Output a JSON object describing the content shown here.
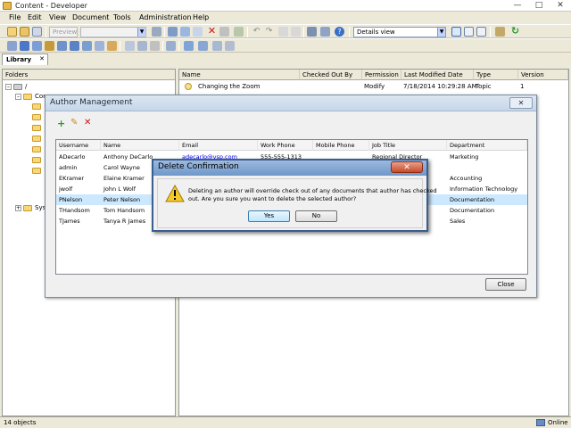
{
  "window": {
    "title": "Content - Developer",
    "controls": [
      "minimize",
      "maximize",
      "close"
    ]
  },
  "menu": [
    "File",
    "Edit",
    "View",
    "Document",
    "Tools",
    "Administration",
    "Help"
  ],
  "toolbar": {
    "preview_label": "Preview",
    "view_select": "Details view"
  },
  "library_tab": {
    "label": "Library",
    "close": "✕"
  },
  "folders": {
    "header": "Folders",
    "root": "/",
    "items": [
      "Con",
      "Sys"
    ]
  },
  "documents": {
    "columns": [
      "Name",
      "Checked Out By",
      "Permission",
      "Last Modified Date",
      "Type",
      "Version"
    ],
    "rows": [
      {
        "name": "Changing the Zoom",
        "checked_out_by": "",
        "permission": "Modify",
        "last_modified": "7/18/2014 10:29:28 AM",
        "type": "Topic",
        "version": "1"
      }
    ]
  },
  "author_dialog": {
    "title": "Author Management",
    "close": "✕",
    "columns": [
      "Username",
      "Name",
      "Email",
      "Work Phone",
      "Mobile Phone",
      "Job Title",
      "Department"
    ],
    "rows": [
      {
        "username": "ADecarlo",
        "name": "Anthony  DeCarlo",
        "email": "adecarlo@vsp.com",
        "work": "555-555-1313",
        "mobile": "",
        "job": "Regional Director",
        "dept": "Marketing"
      },
      {
        "username": "admin",
        "name": "Carol  Wayne",
        "email": "",
        "work": "",
        "mobile": "",
        "job": "",
        "dept": ""
      },
      {
        "username": "EKramer",
        "name": "Elaine  Kramer",
        "email": "",
        "work": "",
        "mobile": "",
        "job": "",
        "dept": "Accounting"
      },
      {
        "username": "jwolf",
        "name": "John L Wolf",
        "email": "",
        "work": "",
        "mobile": "",
        "job": "",
        "dept": "Information Technology"
      },
      {
        "username": "PNelson",
        "name": "Peter  Nelson",
        "email": "",
        "work": "",
        "mobile": "",
        "job": "",
        "dept": "Documentation"
      },
      {
        "username": "THandsom",
        "name": "Tom  Handsom",
        "email": "",
        "work": "",
        "mobile": "",
        "job": "",
        "dept": "Documentation"
      },
      {
        "username": "TJames",
        "name": "Tanya R James",
        "email": "",
        "work": "",
        "mobile": "",
        "job": "",
        "dept": "Sales"
      }
    ],
    "selected_username": "PNelson",
    "close_button": "Close"
  },
  "delete_dialog": {
    "title": "Delete Confirmation",
    "close": "✕",
    "message_line1": "Deleting an author will override check out of any documents that author has checked",
    "message_line2": "out.  Are you sure you want to delete the selected author?",
    "yes_label": "Yes",
    "no_label": "No"
  },
  "status": {
    "count": "14 objects",
    "connection": "Online"
  },
  "colors": {
    "selection": "#cce8ff",
    "link": "#0000ee",
    "dialog_title": "#c6d6ea",
    "close_red": "#c84a2a"
  }
}
